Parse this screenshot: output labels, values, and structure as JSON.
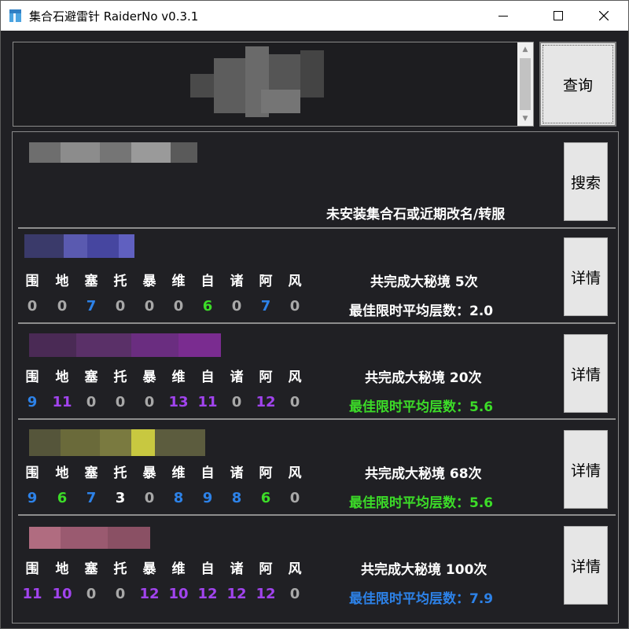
{
  "window": {
    "title": "集合石避雷针 RaiderNo v0.3.1",
    "controls": [
      "minimize",
      "maximize",
      "close"
    ]
  },
  "query": {
    "input_value": "",
    "button_label": "查询"
  },
  "search": {
    "button_label": "搜索",
    "status": "未安装集合石或近期改名/转服"
  },
  "dungeon_abbrevs": [
    "围",
    "地",
    "塞",
    "托",
    "暴",
    "维",
    "自",
    "诸",
    "阿",
    "风"
  ],
  "colors": {
    "gray": "#a8a8a8",
    "blue": "#2d82e8",
    "green": "#3cdc28",
    "purple": "#a144ee",
    "white": "#ffffff"
  },
  "players": [
    {
      "counts": [
        "0",
        "0",
        "7",
        "0",
        "0",
        "0",
        "6",
        "0",
        "7",
        "0"
      ],
      "count_colors": [
        "gray",
        "gray",
        "blue",
        "gray",
        "gray",
        "gray",
        "green",
        "gray",
        "blue",
        "gray"
      ],
      "summary": "共完成大秘境 5次",
      "best_label": "最佳限时平均层数：2.0",
      "best_color": "white",
      "detail_label": "详情"
    },
    {
      "counts": [
        "9",
        "11",
        "0",
        "0",
        "0",
        "13",
        "11",
        "0",
        "12",
        "0"
      ],
      "count_colors": [
        "blue",
        "purple",
        "gray",
        "gray",
        "gray",
        "purple",
        "purple",
        "gray",
        "purple",
        "gray"
      ],
      "summary": "共完成大秘境 20次",
      "best_label": "最佳限时平均层数：5.6",
      "best_color": "green",
      "detail_label": "详情"
    },
    {
      "counts": [
        "9",
        "6",
        "7",
        "3",
        "0",
        "8",
        "9",
        "8",
        "6",
        "0"
      ],
      "count_colors": [
        "blue",
        "green",
        "blue",
        "white",
        "gray",
        "blue",
        "blue",
        "blue",
        "green",
        "gray"
      ],
      "summary": "共完成大秘境 68次",
      "best_label": "最佳限时平均层数：5.6",
      "best_color": "green",
      "detail_label": "详情"
    },
    {
      "counts": [
        "11",
        "10",
        "0",
        "0",
        "12",
        "10",
        "12",
        "12",
        "12",
        "0"
      ],
      "count_colors": [
        "purple",
        "purple",
        "gray",
        "gray",
        "purple",
        "purple",
        "purple",
        "purple",
        "purple",
        "gray"
      ],
      "summary": "共完成大秘境 100次",
      "best_label": "最佳限时平均层数：7.9",
      "best_color": "blue",
      "detail_label": "详情"
    }
  ]
}
